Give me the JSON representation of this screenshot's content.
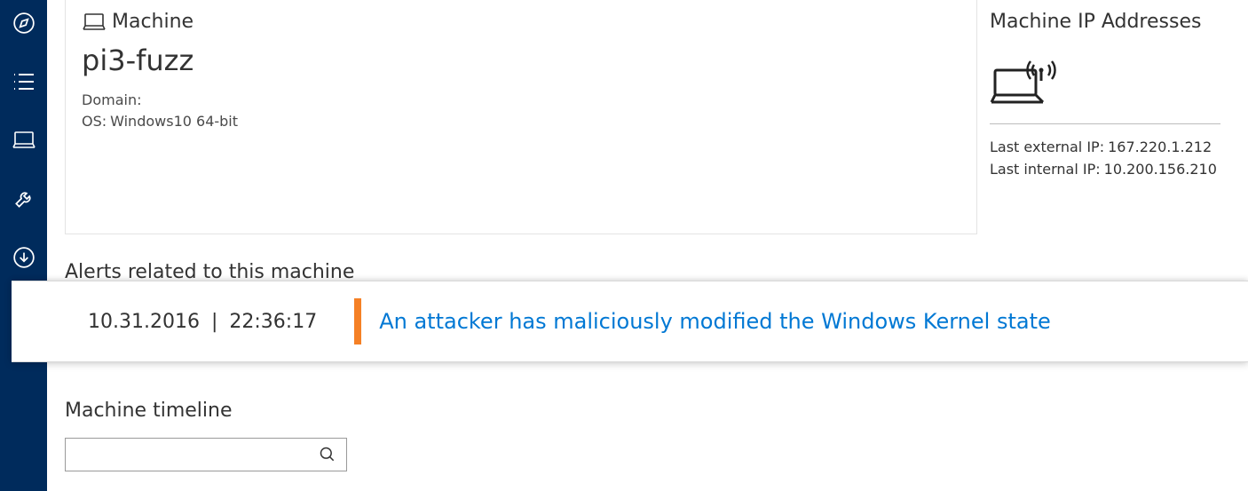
{
  "sidebar": {
    "items": [
      {
        "name": "compass"
      },
      {
        "name": "list"
      },
      {
        "name": "machine"
      },
      {
        "name": "wrench"
      },
      {
        "name": "download"
      }
    ]
  },
  "machine": {
    "card_label": "Machine",
    "name": "pi3-fuzz",
    "domain_label": "Domain:",
    "domain_value": "",
    "os_label": "OS:",
    "os_value": "Windows10 64-bit"
  },
  "ip": {
    "title": "Machine IP Addresses",
    "external_label": "Last external IP:",
    "external_value": "167.220.1.212",
    "internal_label": "Last internal IP:",
    "internal_value": "10.200.156.210"
  },
  "alerts": {
    "section_title": "Alerts related to this machine",
    "items": [
      {
        "date": "10.31.2016",
        "time": "22:36:17",
        "severity_color": "#f58025",
        "title": "An attacker has maliciously modified the Windows Kernel state"
      }
    ]
  },
  "timeline": {
    "title": "Machine timeline",
    "search_placeholder": ""
  }
}
